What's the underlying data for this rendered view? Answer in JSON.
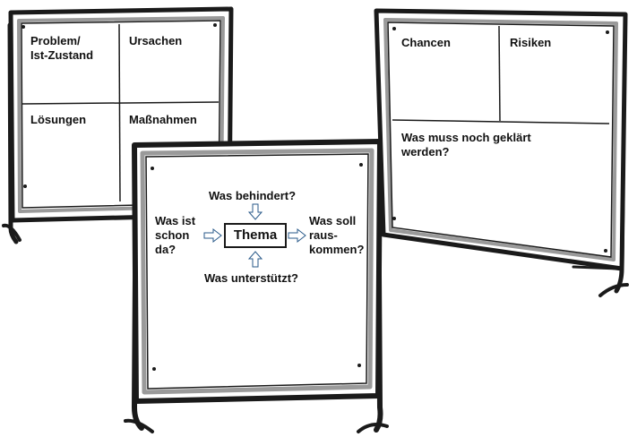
{
  "boards": {
    "left": {
      "q1": "Problem/\nIst-Zustand",
      "q2": "Ursachen",
      "q3": "Lösungen",
      "q4": "Maßnahmen"
    },
    "right": {
      "q1": "Chancen",
      "q2": "Risiken",
      "bottom": "Was muss noch geklärt\nwerden?"
    },
    "center": {
      "top": "Was behindert?",
      "left": "Was ist\nschon\nda?",
      "center": "Thema",
      "right": "Was soll\nraus-\nkommen?",
      "bottom": "Was unterstützt?"
    }
  },
  "colors": {
    "ink": "#111111",
    "frame": "#1a1a1a",
    "frame_highlight": "#9a9a9a",
    "arrow": "#2a5a8a",
    "paper": "#ffffff"
  }
}
